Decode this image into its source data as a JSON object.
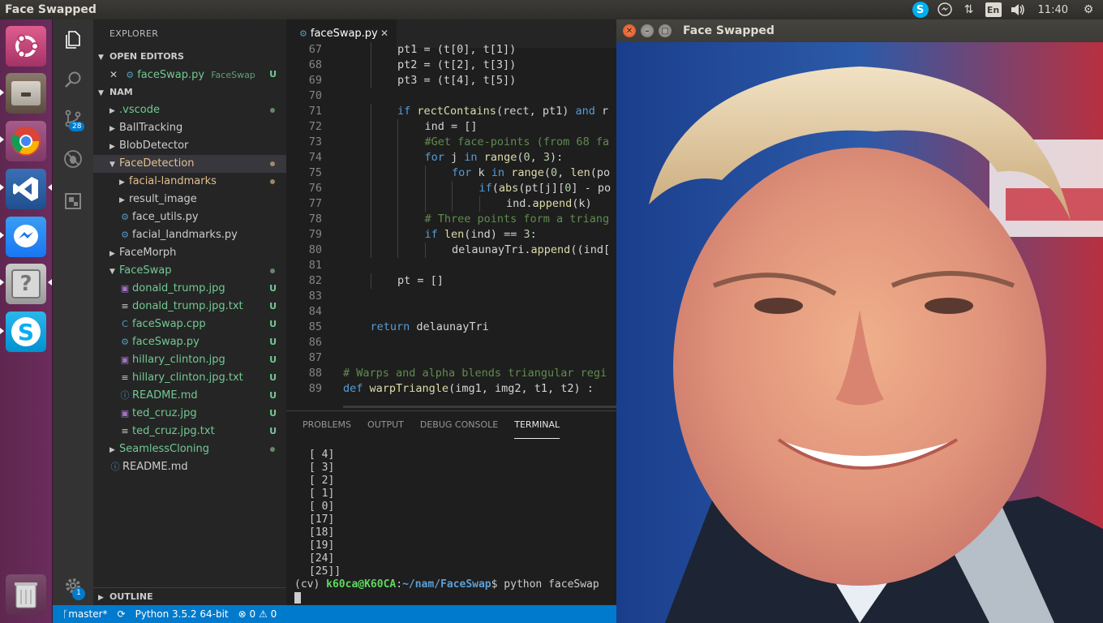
{
  "top_panel": {
    "title": "Face Swapped",
    "clock": "11:40",
    "lang": "En"
  },
  "launcher": {
    "items": [
      "ubuntu-dash",
      "files",
      "chrome",
      "vscode",
      "messenger",
      "unknown-app",
      "skype",
      "trash"
    ]
  },
  "activity_bar": {
    "scm_badge": "28",
    "settings_badge": "1"
  },
  "explorer": {
    "title": "EXPLORER",
    "open_editors_label": "OPEN EDITORS",
    "open_editor": {
      "close": "✕",
      "name": "faceSwap.py",
      "folder": "FaceSwap",
      "status": "U"
    },
    "root_label": "NAM",
    "tree": [
      {
        "name": ".vscode",
        "kind": "folder",
        "open": false,
        "depth": 0,
        "color": "green",
        "marker": "dot"
      },
      {
        "name": "BallTracking",
        "kind": "folder",
        "open": false,
        "depth": 0,
        "color": "plain",
        "marker": ""
      },
      {
        "name": "BlobDetector",
        "kind": "folder",
        "open": false,
        "depth": 0,
        "color": "plain",
        "marker": ""
      },
      {
        "name": "FaceDetection",
        "kind": "folder",
        "open": true,
        "depth": 0,
        "color": "yellow",
        "marker": "dot",
        "selected": true
      },
      {
        "name": "facial-landmarks",
        "kind": "folder",
        "open": false,
        "depth": 1,
        "color": "yellow",
        "marker": "dot"
      },
      {
        "name": "result_image",
        "kind": "folder",
        "open": false,
        "depth": 1,
        "color": "plain",
        "marker": ""
      },
      {
        "name": "face_utils.py",
        "kind": "py",
        "depth": 1,
        "color": "plain",
        "marker": ""
      },
      {
        "name": "facial_landmarks.py",
        "kind": "py",
        "depth": 1,
        "color": "plain",
        "marker": ""
      },
      {
        "name": "FaceMorph",
        "kind": "folder",
        "open": false,
        "depth": 0,
        "color": "plain",
        "marker": ""
      },
      {
        "name": "FaceSwap",
        "kind": "folder",
        "open": true,
        "depth": 0,
        "color": "green",
        "marker": "dot"
      },
      {
        "name": "donald_trump.jpg",
        "kind": "img",
        "depth": 1,
        "color": "green",
        "marker": "U"
      },
      {
        "name": "donald_trump.jpg.txt",
        "kind": "txt",
        "depth": 1,
        "color": "green",
        "marker": "U"
      },
      {
        "name": "faceSwap.cpp",
        "kind": "cpp",
        "depth": 1,
        "color": "green",
        "marker": "U"
      },
      {
        "name": "faceSwap.py",
        "kind": "py",
        "depth": 1,
        "color": "green",
        "marker": "U"
      },
      {
        "name": "hillary_clinton.jpg",
        "kind": "img",
        "depth": 1,
        "color": "green",
        "marker": "U"
      },
      {
        "name": "hillary_clinton.jpg.txt",
        "kind": "txt",
        "depth": 1,
        "color": "green",
        "marker": "U"
      },
      {
        "name": "README.md",
        "kind": "info",
        "depth": 1,
        "color": "green",
        "marker": "U"
      },
      {
        "name": "ted_cruz.jpg",
        "kind": "img",
        "depth": 1,
        "color": "green",
        "marker": "U"
      },
      {
        "name": "ted_cruz.jpg.txt",
        "kind": "txt",
        "depth": 1,
        "color": "green",
        "marker": "U"
      },
      {
        "name": "SeamlessCloning",
        "kind": "folder",
        "open": false,
        "depth": 0,
        "color": "green",
        "marker": "dot"
      },
      {
        "name": "README.md",
        "kind": "info",
        "depth": 0,
        "color": "plain",
        "marker": ""
      }
    ],
    "outline_label": "OUTLINE"
  },
  "editor": {
    "tab_name": "faceSwap.py",
    "tab_close": "✕",
    "lines": [
      {
        "n": "67",
        "indent": 2,
        "html": "pt1 = (t[0], t[1])"
      },
      {
        "n": "68",
        "indent": 2,
        "html": "pt2 = (t[2], t[3])"
      },
      {
        "n": "69",
        "indent": 2,
        "html": "pt3 = (t[4], t[5])"
      },
      {
        "n": "70",
        "indent": 0,
        "html": ""
      },
      {
        "n": "71",
        "indent": 2,
        "html": "<span class=\"k\">if</span> <span class=\"fn\">rectContains</span>(rect, pt1) <span class=\"k\">and</span> r"
      },
      {
        "n": "72",
        "indent": 3,
        "html": "ind = []"
      },
      {
        "n": "73",
        "indent": 3,
        "html": "<span class=\"cm\">#Get face-points (from 68 fa</span>"
      },
      {
        "n": "74",
        "indent": 3,
        "html": "<span class=\"k\">for</span> j <span class=\"k\">in</span> <span class=\"fn\">range</span>(<span class=\"nm\">0</span>, <span class=\"nm\">3</span>):"
      },
      {
        "n": "75",
        "indent": 4,
        "html": "<span class=\"k\">for</span> k <span class=\"k\">in</span> <span class=\"fn\">range</span>(<span class=\"nm\">0</span>, <span class=\"fn\">len</span>(po"
      },
      {
        "n": "76",
        "indent": 5,
        "html": "<span class=\"k\">if</span>(<span class=\"fn\">abs</span>(pt[j][<span class=\"nm\">0</span>] - po"
      },
      {
        "n": "77",
        "indent": 6,
        "html": "ind.<span class=\"fn\">append</span>(k)"
      },
      {
        "n": "78",
        "indent": 3,
        "html": "<span class=\"cm\"># Three points form a triang</span>"
      },
      {
        "n": "79",
        "indent": 3,
        "html": "<span class=\"k\">if</span> <span class=\"fn\">len</span>(ind) == <span class=\"nm\">3</span>:"
      },
      {
        "n": "80",
        "indent": 4,
        "html": "delaunayTri.<span class=\"fn\">append</span>((ind["
      },
      {
        "n": "81",
        "indent": 0,
        "html": ""
      },
      {
        "n": "82",
        "indent": 2,
        "html": "pt = []"
      },
      {
        "n": "83",
        "indent": 0,
        "html": ""
      },
      {
        "n": "84",
        "indent": 0,
        "html": ""
      },
      {
        "n": "85",
        "indent": 1,
        "html": "<span class=\"k\">return</span> delaunayTri"
      },
      {
        "n": "86",
        "indent": 0,
        "html": ""
      },
      {
        "n": "87",
        "indent": 0,
        "html": ""
      },
      {
        "n": "88",
        "indent": 0,
        "html": "<span class=\"cm\"># Warps and alpha blends triangular regi</span>"
      },
      {
        "n": "89",
        "indent": 0,
        "html": "<span class=\"k\">def</span> <span class=\"fn\">warpTriangle</span>(img1, img2, t1, t2) :"
      }
    ]
  },
  "panel": {
    "tabs": [
      "PROBLEMS",
      "OUTPUT",
      "DEBUG CONSOLE",
      "TERMINAL"
    ],
    "active_tab": "TERMINAL",
    "output_lines": [
      "[ 4]",
      "[ 3]",
      "[ 2]",
      "[ 1]",
      "[ 0]",
      "[17]",
      "[18]",
      "[19]",
      "[24]",
      "[25]]"
    ],
    "prompt": {
      "env": "(cv) ",
      "user": "k60ca@K60CA",
      "sep": ":",
      "path": "~/nam/FaceSwap",
      "dollar": "$ ",
      "cmd": "python faceSwap"
    }
  },
  "statusbar": {
    "branch": "master*",
    "python": "Python 3.5.2 64-bit",
    "errors": "0",
    "warnings": "0"
  },
  "image_window": {
    "title": "Face Swapped"
  },
  "colors": {
    "accent": "#007acc",
    "launcher": "#5e2750",
    "untracked": "#73c991",
    "modified": "#e2c08d"
  }
}
